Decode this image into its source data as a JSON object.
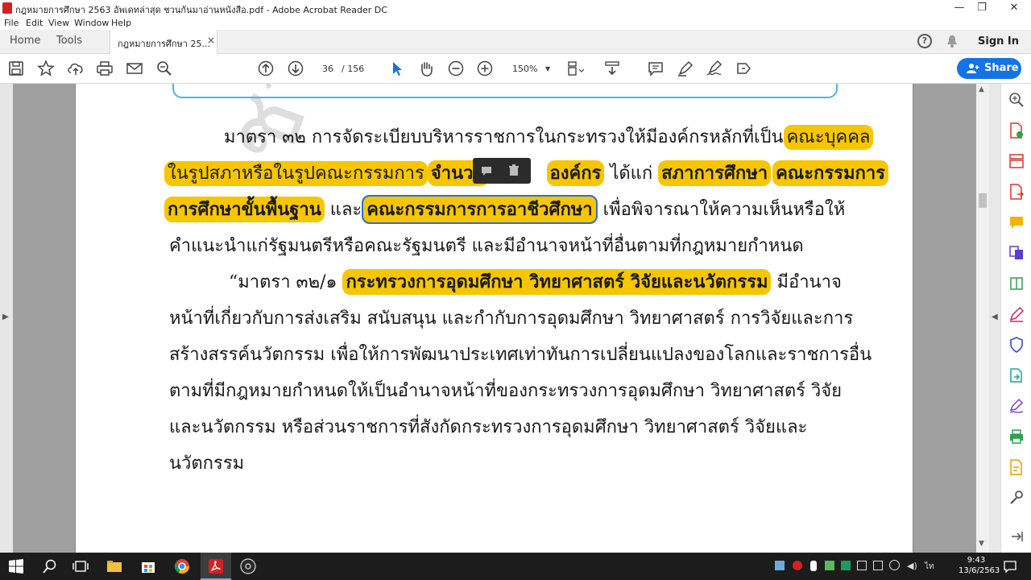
{
  "window": {
    "title": "กฎหมายการศึกษา 2563 อัพเดทล่าสุด ชวนกันมาอ่านหนังสือ.pdf - Adobe Acrobat Reader DC",
    "controls": [
      "—",
      "❐",
      "✕"
    ]
  },
  "menu": [
    "File",
    "Edit",
    "View",
    "Window",
    "Help"
  ],
  "tabs": {
    "home": "Home",
    "tools": "Tools",
    "document": "กฎหมายการศึกษา 25...",
    "close": "×"
  },
  "header": {
    "signin": "Sign In",
    "help": "?"
  },
  "toolbar": {
    "page_current": "36",
    "page_total": "/  156",
    "zoom": "150%",
    "share": "Share"
  },
  "document": {
    "para1": {
      "line1_plain": "มาตรา ๓๒ การจัดระเบียบบริหารราชการในกระทรวงให้มีองค์กรหลักที่เป็น",
      "line1_hl": "คณะบุคคล",
      "line2_hl_a": "ในรูปสภาหรือในรูปคณะกรรมการ",
      "line2_hl_b": "จำนวน",
      "line2_hl_c": "องค์กร",
      "line2_plain": " ได้แก่ ",
      "line2_hl_d": "สภาการศึกษา",
      "line2_hl_e": "คณะกรรมการ",
      "line3_hl_a": "การศึกษาขั้นพื้นฐาน",
      "line3_plain_a": " และ",
      "line3_hl_b": "คณะกรรมการการอาชีวศึกษา",
      "line3_plain_b": " เพื่อพิจารณาให้ความเห็นหรือให้",
      "line4": "คำแนะนำแก่รัฐมนตรีหรือคณะรัฐมนตรี และมีอำนาจหน้าที่อื่นตามที่กฎหมายกำหนด"
    },
    "para2": {
      "line1_plain_a": "“มาตรา ๓๒/๑ ",
      "line1_hl": "กระทรวงการอุดมศึกษา วิทยาศาสตร์ วิจัยและนวัตกรรม",
      "line1_plain_b": " มีอำนาจ",
      "line2": "หน้าที่เกี่ยวกับการส่งเสริม สนับสนุน และกำกับการอุดมศึกษา วิทยาศาสตร์ การวิจัยและการ",
      "line3": "สร้างสรรค์นวัตกรรม เพื่อให้การพัฒนาประเทศเท่าทันการเปลี่ยนแปลงของโลกและราชการอื่น",
      "line4": "ตามที่มีกฎหมายกำหนดให้เป็นอำนาจหน้าที่ของกระทรวงการอุดมศึกษา วิทยาศาสตร์ วิจัย",
      "line5": "และนวัตกรรม หรือส่วนราชการที่สังกัดกระทรวงการอุดมศึกษา วิทยาศาสตร์ วิจัยและ",
      "line6": "นวัตกรรม"
    },
    "watermark": "ชวนกันมาอ่าน"
  },
  "taskbar": {
    "time": "9:43",
    "date": "13/6/2563"
  },
  "colors": {
    "highlight": "#f7c600",
    "accent": "#1473e6",
    "selection": "#2b6fd6"
  }
}
